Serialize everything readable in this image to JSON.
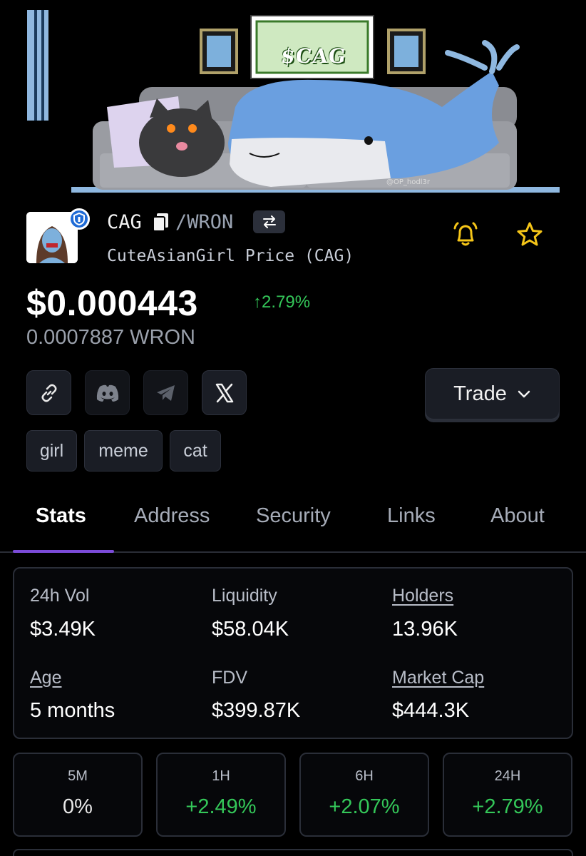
{
  "banner": {
    "headline": "$CAG",
    "credit": "@OP_hodl3r"
  },
  "token": {
    "symbol": "CAG",
    "pair_separator": "/WRON",
    "full_name": "CuteAsianGirl Price (CAG)",
    "price": "$0.000443",
    "change_24h": "↑2.79%",
    "price_in_wron": "0.0007887 WRON",
    "verified": true
  },
  "social": {
    "icons": [
      "link-icon",
      "discord-icon",
      "telegram-icon",
      "x-icon"
    ]
  },
  "trade": {
    "label": "Trade"
  },
  "tags": [
    "girl",
    "meme",
    "cat"
  ],
  "tabs": [
    {
      "label": "Stats",
      "active": true
    },
    {
      "label": "Address",
      "active": false
    },
    {
      "label": "Security",
      "active": false
    },
    {
      "label": "Links",
      "active": false
    },
    {
      "label": "About",
      "active": false
    }
  ],
  "stats": {
    "vol_24h": {
      "label": "24h Vol",
      "value": "$3.49K"
    },
    "liquidity": {
      "label": "Liquidity",
      "value": "$58.04K"
    },
    "holders": {
      "label": "Holders",
      "value": "13.96K"
    },
    "age": {
      "label": "Age",
      "value": "5 months"
    },
    "fdv": {
      "label": "FDV",
      "value": "$399.87K"
    },
    "market_cap": {
      "label": "Market Cap",
      "value": "$444.3K"
    }
  },
  "changes": [
    {
      "period": "5M",
      "value": "0%"
    },
    {
      "period": "1H",
      "value": "+2.49%"
    },
    {
      "period": "6H",
      "value": "+2.07%"
    },
    {
      "period": "24H",
      "value": "+2.79%"
    }
  ],
  "colors": {
    "positive": "#34c759",
    "accent": "#7b4bd8",
    "bell": "#f5c518",
    "star": "#f5c518"
  }
}
